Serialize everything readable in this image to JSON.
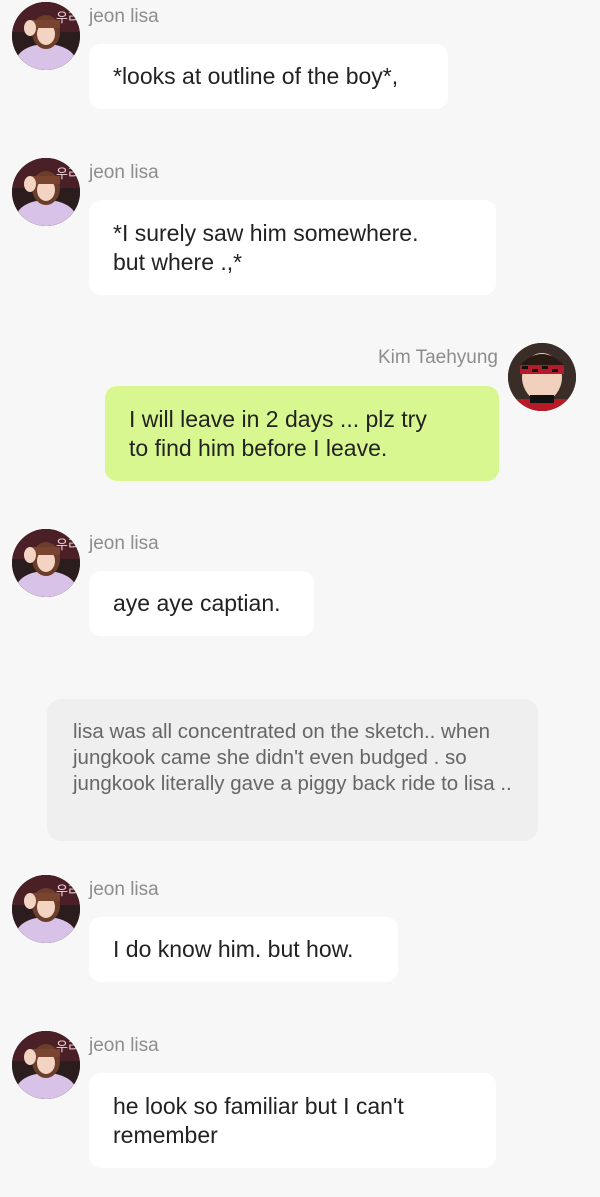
{
  "messages": [
    {
      "sender": "jeon lisa",
      "text": "*looks at outline of the boy*,"
    },
    {
      "sender": "jeon lisa",
      "text": "*I surely saw him somewhere.\nbut where .,*"
    },
    {
      "sender": "Kim Taehyung",
      "text": "I will leave in 2 days ... plz try\nto find him before I leave."
    },
    {
      "sender": "jeon lisa",
      "text": "aye aye captian."
    },
    {
      "sender": "jeon lisa",
      "text": "I do know him. but how."
    },
    {
      "sender": "jeon lisa",
      "text": "he look so familiar but I can't\nremember"
    }
  ],
  "narration": {
    "text": "lisa was all concentrated on the sketch.. when jungkook came she didn't even budged . so jungkook literally gave a piggy back ride to lisa .."
  },
  "colors": {
    "background": "#f7f7f7",
    "bubble_other": "#ffffff",
    "bubble_mine": "#d9f790",
    "narration_bg": "#efefef",
    "name_text": "#8d8d8d"
  }
}
